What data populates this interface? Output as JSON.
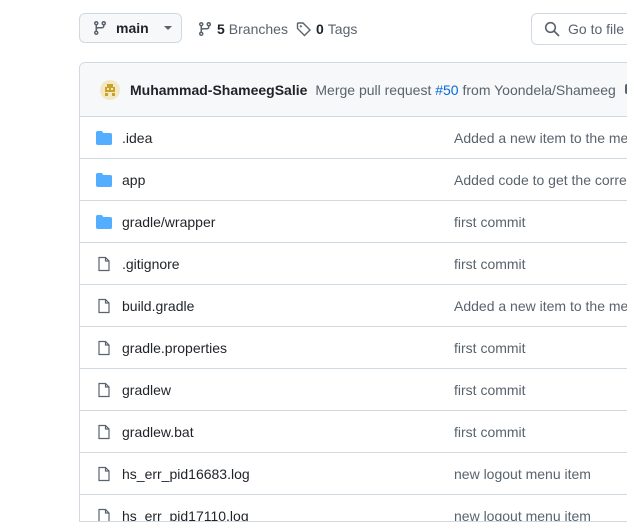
{
  "toolbar": {
    "branch": "main",
    "branches_count": "5",
    "branches_label": "Branches",
    "tags_count": "0",
    "tags_label": "Tags",
    "search_placeholder": "Go to file"
  },
  "latest_commit": {
    "author": "Muhammad-ShameegSalie",
    "message_prefix": "Merge pull request",
    "pr_link": "#50",
    "message_suffix": "from Yoondela/Shameeg"
  },
  "files": [
    {
      "type": "folder",
      "icon": "folder-icon",
      "name": ".idea",
      "message": "Added a new item to the me"
    },
    {
      "type": "folder",
      "icon": "folder-icon",
      "name": "app",
      "message": "Added code to get the corre"
    },
    {
      "type": "folder",
      "icon": "folder-icon",
      "name": "gradle/wrapper",
      "message": "first commit"
    },
    {
      "type": "file",
      "icon": "file-icon",
      "name": ".gitignore",
      "message": "first commit"
    },
    {
      "type": "file",
      "icon": "file-icon",
      "name": "build.gradle",
      "message": "Added a new item to the me"
    },
    {
      "type": "file",
      "icon": "file-icon",
      "name": "gradle.properties",
      "message": "first commit"
    },
    {
      "type": "file",
      "icon": "file-icon",
      "name": "gradlew",
      "message": "first commit"
    },
    {
      "type": "file",
      "icon": "file-icon",
      "name": "gradlew.bat",
      "message": "first commit"
    },
    {
      "type": "file",
      "icon": "file-icon",
      "name": "hs_err_pid16683.log",
      "message": "new logout menu item"
    },
    {
      "type": "file",
      "icon": "file-icon",
      "name": "hs_err_pid17110.log",
      "message": "new logout menu item"
    }
  ],
  "colors": {
    "folder": "#54aeff",
    "link": "#0969da",
    "muted": "#59636e",
    "border": "#d1d9e0"
  }
}
